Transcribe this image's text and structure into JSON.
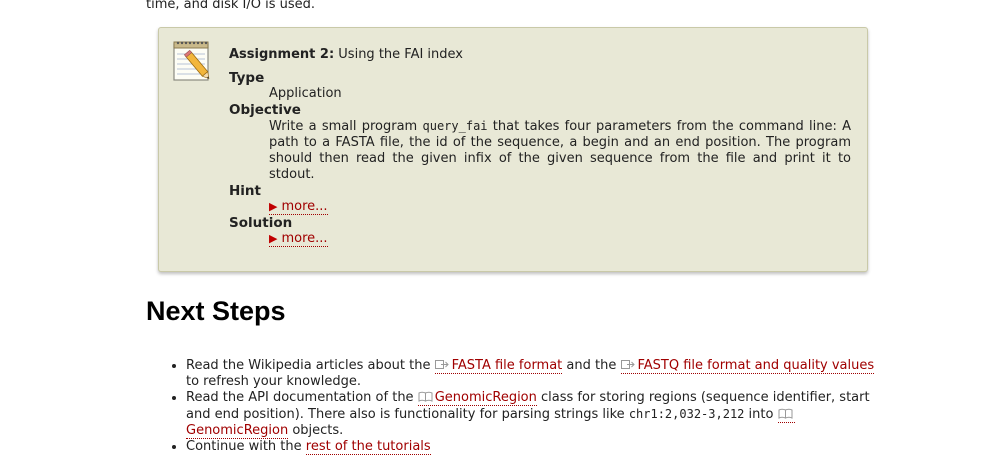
{
  "top_text": "time, and disk I/O is used.",
  "assignment": {
    "label": "Assignment 2:",
    "title": "Using the FAI index",
    "type_label": "Type",
    "type_value": "Application",
    "objective_label": "Objective",
    "objective_pre": "Write a small program ",
    "objective_code": "query_fai",
    "objective_post": " that takes four parameters from the command line: A path to a FASTA file, the id of the sequence, a begin and an end position. The program should then read the given infix of the given sequence from the file and print it to stdout.",
    "hint_label": "Hint",
    "hint_more": "more...",
    "solution_label": "Solution",
    "solution_more": "more..."
  },
  "next_steps": {
    "heading": "Next Steps",
    "item1_pre": "Read the Wikipedia articles about the ",
    "item1_link1": "FASTA file format",
    "item1_mid": " and the ",
    "item1_link2": "FASTQ file format and quality values",
    "item1_post": " to refresh your knowledge.",
    "item2_pre": "Read the API documentation of the ",
    "item2_link1": "GenomicRegion",
    "item2_mid": " class for storing regions (sequence identifier, start and end position). There also is functionality for parsing strings like ",
    "item2_code": "chr1:2,032-3,212",
    "item2_mid2": " into ",
    "item2_link2": "GenomicRegion",
    "item2_post": " objects.",
    "item3_pre": "Continue with the ",
    "item3_link": "rest of the tutorials"
  }
}
